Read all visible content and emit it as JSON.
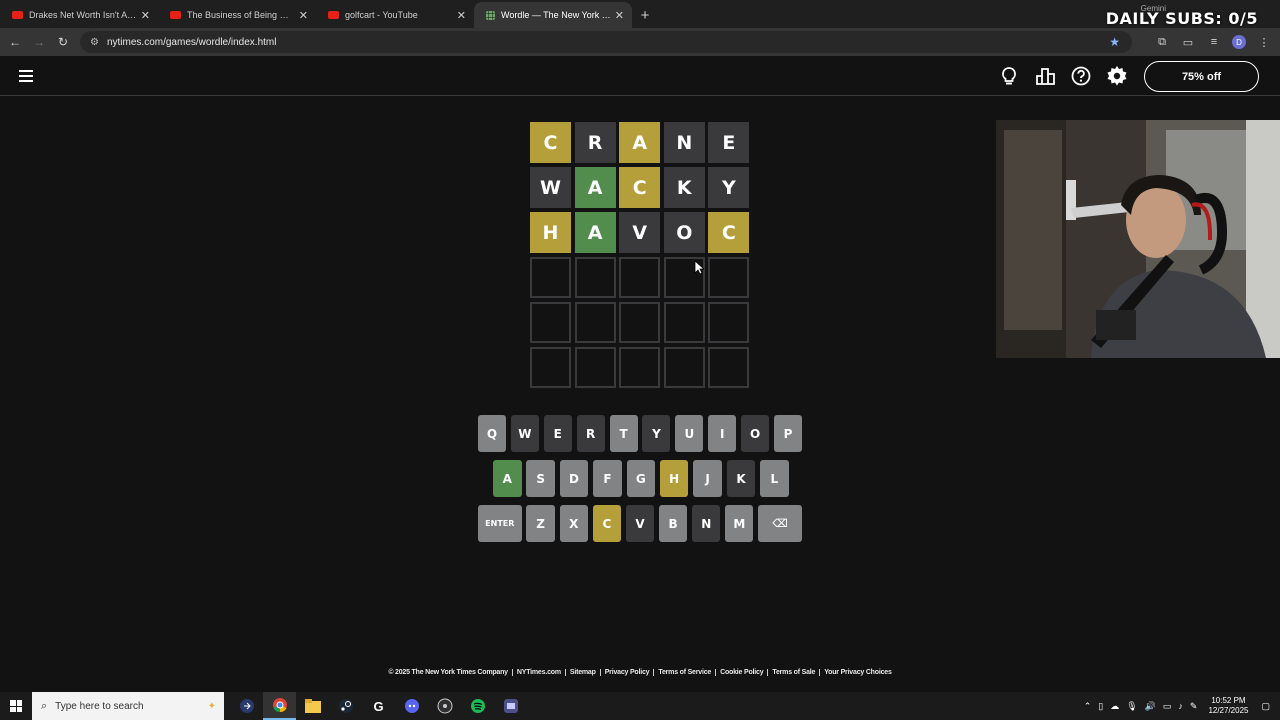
{
  "tabs": [
    {
      "title": "Drakes Net Worth Isn't Adding Up",
      "favicon": "youtube-icon",
      "active": false
    },
    {
      "title": "The Business of Being Hated - YouTube",
      "favicon": "youtube-icon",
      "active": false
    },
    {
      "title": "golfcart - YouTube",
      "favicon": "youtube-icon",
      "active": false
    },
    {
      "title": "Wordle — The New York Times",
      "favicon": "wordle-icon",
      "active": true
    }
  ],
  "overlay": {
    "gemini": "Gemini",
    "daily_subs": "DAILY SUBS: 0/5"
  },
  "browser": {
    "url": "nytimes.com/games/wordle/index.html",
    "profile_initial": "D"
  },
  "header": {
    "promo_label": "75% off"
  },
  "board": {
    "rows": [
      [
        {
          "l": "C",
          "s": "present"
        },
        {
          "l": "R",
          "s": "absent"
        },
        {
          "l": "A",
          "s": "present"
        },
        {
          "l": "N",
          "s": "absent"
        },
        {
          "l": "E",
          "s": "absent"
        }
      ],
      [
        {
          "l": "W",
          "s": "absent"
        },
        {
          "l": "A",
          "s": "correct"
        },
        {
          "l": "C",
          "s": "present"
        },
        {
          "l": "K",
          "s": "absent"
        },
        {
          "l": "Y",
          "s": "absent"
        }
      ],
      [
        {
          "l": "H",
          "s": "present"
        },
        {
          "l": "A",
          "s": "correct"
        },
        {
          "l": "V",
          "s": "absent"
        },
        {
          "l": "O",
          "s": "absent"
        },
        {
          "l": "C",
          "s": "present"
        }
      ],
      [
        {
          "l": "",
          "s": "empty"
        },
        {
          "l": "",
          "s": "empty"
        },
        {
          "l": "",
          "s": "empty"
        },
        {
          "l": "",
          "s": "empty"
        },
        {
          "l": "",
          "s": "empty"
        }
      ],
      [
        {
          "l": "",
          "s": "empty"
        },
        {
          "l": "",
          "s": "empty"
        },
        {
          "l": "",
          "s": "empty"
        },
        {
          "l": "",
          "s": "empty"
        },
        {
          "l": "",
          "s": "empty"
        }
      ],
      [
        {
          "l": "",
          "s": "empty"
        },
        {
          "l": "",
          "s": "empty"
        },
        {
          "l": "",
          "s": "empty"
        },
        {
          "l": "",
          "s": "empty"
        },
        {
          "l": "",
          "s": "empty"
        }
      ]
    ]
  },
  "keyboard": {
    "rows": [
      [
        {
          "k": "Q",
          "s": ""
        },
        {
          "k": "W",
          "s": "absent"
        },
        {
          "k": "E",
          "s": "absent"
        },
        {
          "k": "R",
          "s": "absent"
        },
        {
          "k": "T",
          "s": ""
        },
        {
          "k": "Y",
          "s": "absent"
        },
        {
          "k": "U",
          "s": ""
        },
        {
          "k": "I",
          "s": ""
        },
        {
          "k": "O",
          "s": "absent"
        },
        {
          "k": "P",
          "s": ""
        }
      ],
      [
        {
          "k": "A",
          "s": "correct"
        },
        {
          "k": "S",
          "s": ""
        },
        {
          "k": "D",
          "s": ""
        },
        {
          "k": "F",
          "s": ""
        },
        {
          "k": "G",
          "s": ""
        },
        {
          "k": "H",
          "s": "present"
        },
        {
          "k": "J",
          "s": ""
        },
        {
          "k": "K",
          "s": "absent"
        },
        {
          "k": "L",
          "s": ""
        }
      ],
      [
        {
          "k": "ENTER",
          "s": "",
          "w": "wide"
        },
        {
          "k": "Z",
          "s": ""
        },
        {
          "k": "X",
          "s": ""
        },
        {
          "k": "C",
          "s": "present"
        },
        {
          "k": "V",
          "s": "absent"
        },
        {
          "k": "B",
          "s": ""
        },
        {
          "k": "N",
          "s": "absent"
        },
        {
          "k": "M",
          "s": ""
        },
        {
          "k": "⌫",
          "s": "",
          "w": "back"
        }
      ]
    ]
  },
  "footer": {
    "links": [
      "© 2025 The New York Times Company",
      "NYTimes.com",
      "Sitemap",
      "Privacy Policy",
      "Terms of Service",
      "Cookie Policy",
      "Terms of Sale",
      "Your Privacy Choices"
    ]
  },
  "taskbar": {
    "search_placeholder": "Type here to search",
    "time": "10:52 PM",
    "date": "12/27/2025"
  },
  "colors": {
    "correct": "#538d4e",
    "present": "#b59f3b",
    "absent": "#3a3a3c",
    "key_default": "#818384"
  }
}
